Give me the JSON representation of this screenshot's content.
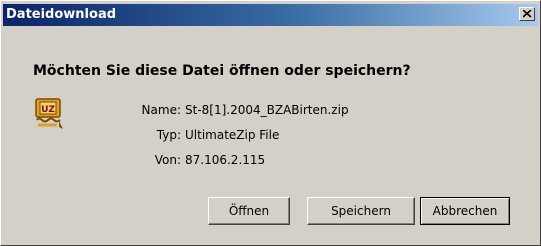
{
  "window": {
    "title": "Dateidownload"
  },
  "dialog": {
    "question": "Möchten Sie diese Datei öffnen oder speichern?",
    "file_icon": "ultimatezip-archive-icon",
    "fields": {
      "name_label": "Name:",
      "name_value": "St-8[1].2004_BZABirten.zip",
      "type_label": "Typ:",
      "type_value": "UltimateZip File",
      "from_label": "Von:",
      "from_value": "87.106.2.115"
    }
  },
  "buttons": {
    "open_label": "Öffnen",
    "save_label": "Speichern",
    "cancel_label": "Abbrechen"
  },
  "icons": {
    "close": "close-icon"
  },
  "colors": {
    "titlebar_start": "#0a246a",
    "titlebar_end": "#a6caf0",
    "dialog_face": "#d4d0c8"
  }
}
